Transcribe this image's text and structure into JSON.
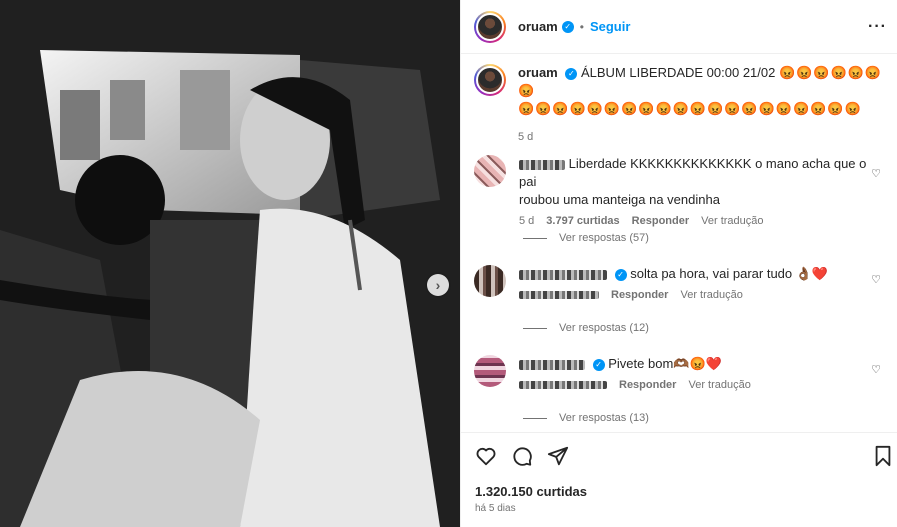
{
  "post": {
    "username": "oruam",
    "follow_label": "Seguir",
    "more_icon": "more-horizontal-icon"
  },
  "caption": {
    "username": "oruam",
    "text": "ÁLBUM LIBERDADE 00:00 21/02",
    "emojis_line1": "😡😡😡😡😡😡😡",
    "emojis_line2": "😡😡😡😡😡😡😡😡😡😡😡😡😡😡😡😡😡😡😡😡",
    "age": "5 d"
  },
  "comments": [
    {
      "text": "Liberdade KKKKKKKKKKKKKK o mano acha que o pai",
      "text2": "roubou uma manteiga na vendinha",
      "age": "5 d",
      "likes": "3.797 curtidas",
      "reply": "Responder",
      "translate": "Ver tradução",
      "view_replies": "Ver respostas (57)"
    },
    {
      "text": "solta pa hora, vai parar tudo 👌🏾❤️",
      "reply": "Responder",
      "translate": "Ver tradução",
      "view_replies": "Ver respostas (12)"
    },
    {
      "text": "Pivete bom🫶🏾😡❤️",
      "reply": "Responder",
      "translate": "Ver tradução",
      "view_replies": "Ver respostas (13)"
    }
  ],
  "footer": {
    "likes": "1.320.150 curtidas",
    "time_ago": "há 5 dias"
  }
}
